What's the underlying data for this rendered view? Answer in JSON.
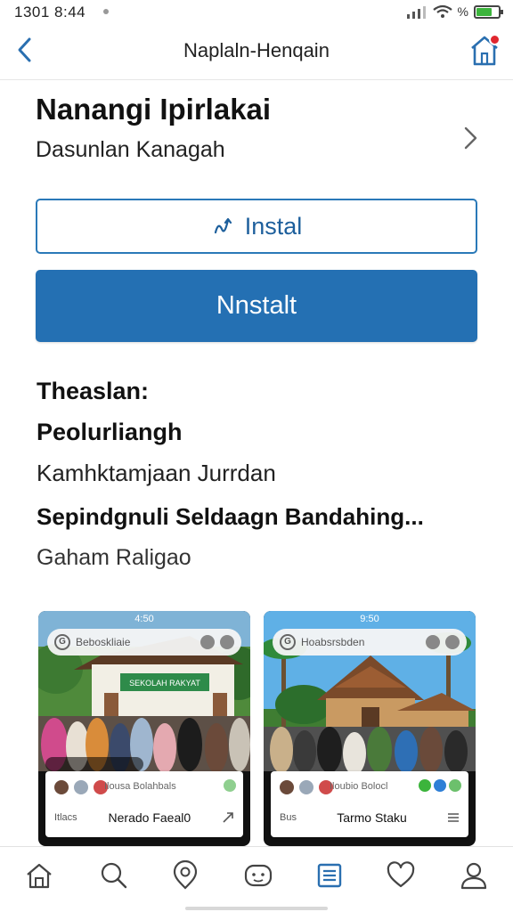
{
  "status": {
    "time": "1301 8:44",
    "battery_text": "%",
    "battery_level": 0.7
  },
  "appbar": {
    "title": "Naplaln-Henqain"
  },
  "app": {
    "name": "Nanangi Ipirlakai",
    "developer": "Dasunlan Kanagah"
  },
  "buttons": {
    "secondary_label": "Instal",
    "primary_label": "Nnstalt"
  },
  "info": {
    "line1": "Theaslan:",
    "line2": "Peolurliangh",
    "line3": "Kamhktamjaan Jurrdan",
    "line4": "Sepindgnuli Seldaagn Bandahing...",
    "line5": "Gaham Raligao"
  },
  "screenshots": [
    {
      "status": "4:50",
      "search_text": "Beboskliaie",
      "meta": "Ilousa Bolahbals",
      "small": "Itlacs",
      "title": "Nerado Faeal0",
      "sign_text": "SEKOLAH RAKYAT"
    },
    {
      "status": "9:50",
      "search_text": "Hoabsrsbden",
      "meta": "Iloubio Bolocl",
      "small": "Bus",
      "title": "Tarmo Staku"
    }
  ],
  "colors": {
    "accent": "#2470b3",
    "accent_dark": "#1d5f9c",
    "badge": "#e0262e",
    "battery": "#3cb43c"
  },
  "icons": {
    "back": "chevron-left-icon",
    "home": "house-icon",
    "chevron": "chevron-right-icon",
    "nav": [
      "home-icon",
      "search-icon",
      "location-icon",
      "face-icon",
      "list-icon",
      "heart-icon",
      "profile-icon"
    ]
  }
}
